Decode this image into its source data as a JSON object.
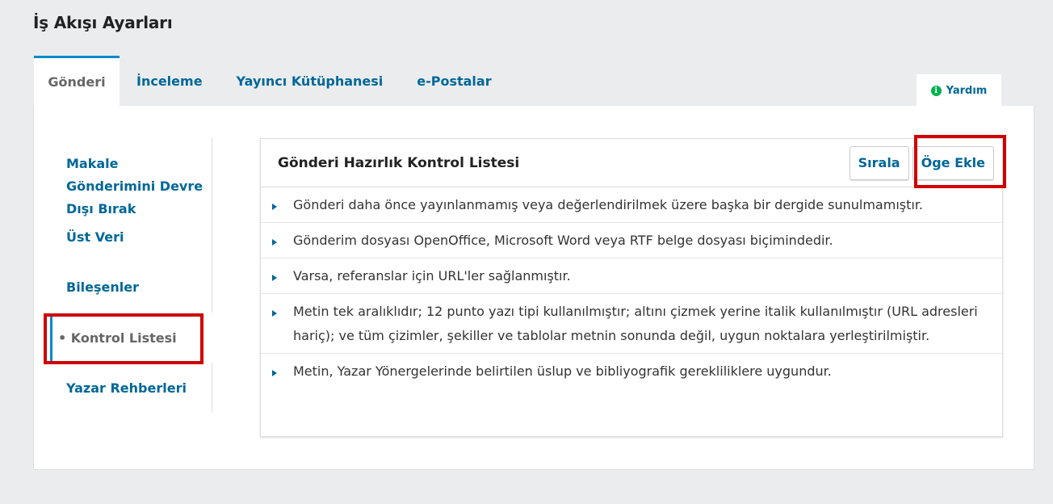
{
  "page": {
    "title": "İş Akışı Ayarları"
  },
  "tabs": [
    {
      "label": "Gönderi",
      "active": true
    },
    {
      "label": "İnceleme"
    },
    {
      "label": "Yayıncı Kütüphanesi"
    },
    {
      "label": "e-Postalar"
    }
  ],
  "help": {
    "label": "Yardım",
    "icon": "info-icon",
    "icon_glyph": "i"
  },
  "side_nav": {
    "items": [
      {
        "label": "Makale Gönderimini Devre Dışı Bırak"
      },
      {
        "label": "Üst Veri"
      },
      {
        "label": "Bileşenler"
      },
      {
        "label": "• Kontrol Listesi",
        "active": true
      },
      {
        "label": "Yazar Rehberleri"
      }
    ]
  },
  "checklist": {
    "title": "Gönderi Hazırlık Kontrol Listesi",
    "sort_label": "Sırala",
    "add_label": "Öge Ekle",
    "items": [
      "Gönderi daha önce yayınlanmamış veya değerlendirilmek üzere başka bir dergide sunulmamıştır.",
      "Gönderim dosyası OpenOffice, Microsoft Word veya RTF belge dosyası biçimindedir.",
      "Varsa, referanslar için URL'ler sağlanmıştır.",
      "Metin tek aralıklıdır; 12 punto yazı tipi kullanılmıştır; altını çizmek yerine italik kullanılmıştır (URL adresleri hariç); ve tüm çizimler, şekiller ve tablolar metnin sonunda değil, uygun noktalara yerleştirilmiştir.",
      "Metin, Yazar Yönergelerinde belirtilen üslup ve bibliyografik gerekliliklere uygundur."
    ]
  },
  "colors": {
    "link": "#006798",
    "accent": "#008acb",
    "highlight": "#d00000",
    "help_icon": "#00b24e"
  }
}
